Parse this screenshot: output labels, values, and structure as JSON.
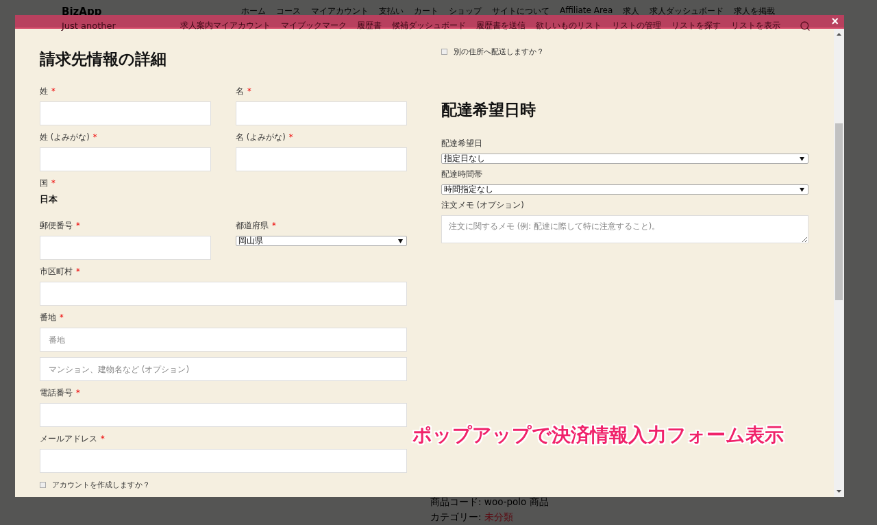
{
  "site": {
    "logo": "BizApp",
    "tagline": "Just another",
    "nav_primary": [
      "ホーム",
      "コース",
      "マイアカウント",
      "支払い",
      "カート",
      "ショップ",
      "サイトについて",
      "Affiliate Area",
      "求人",
      "求人ダッシュボード",
      "求人を掲載"
    ],
    "nav_secondary": [
      "求人案内マイアカウント",
      "マイブックマーク",
      "履歴書",
      "候補ダッシュボード",
      "履歴書を送信",
      "欲しいものリスト",
      "リストの管理",
      "リストを探す",
      "リストを表示"
    ]
  },
  "popup": {
    "close_glyph": "×",
    "billing": {
      "title": "請求先情報の詳細",
      "rows": [
        [
          {
            "kind": "input",
            "label": "姓",
            "mark": "*"
          },
          {
            "kind": "input",
            "label": "名",
            "mark": "*"
          }
        ],
        [
          {
            "kind": "input",
            "label": "姓 (よみがな)",
            "mark": "*"
          },
          {
            "kind": "input",
            "label": "名 (よみがな)",
            "mark": "*"
          }
        ],
        [
          {
            "kind": "static",
            "label": "国",
            "mark": "*",
            "value": "日本"
          }
        ],
        [
          {
            "kind": "input",
            "label": "郵便番号",
            "mark": "*"
          },
          {
            "kind": "select",
            "label": "都道府県",
            "mark": "*",
            "value": "岡山県"
          }
        ],
        [
          {
            "kind": "input",
            "label": "市区町村",
            "mark": "*"
          }
        ],
        [
          {
            "kind": "input",
            "label": "番地",
            "mark": "*",
            "placeholder": "番地"
          }
        ],
        [
          {
            "kind": "input",
            "placeholder": "マンション、建物名など (オプション)"
          }
        ],
        [
          {
            "kind": "input",
            "label": "電話番号",
            "mark": "*"
          }
        ],
        [
          {
            "kind": "input",
            "label": "メールアドレス",
            "mark": "*"
          }
        ],
        [
          {
            "kind": "checkbox",
            "label": "アカウントを作成しますか？",
            "checked": false
          }
        ]
      ]
    },
    "shipping": {
      "kind": "checkbox",
      "label": "別の住所へ配送しますか？",
      "checked": false
    },
    "delivery": {
      "title": "配達希望日時",
      "fields": [
        {
          "kind": "select",
          "label": "配達希望日",
          "value": "指定日なし"
        },
        {
          "kind": "select",
          "label": "配達時間帯",
          "value": "時間指定なし"
        },
        {
          "kind": "textarea",
          "label": "注文メモ (オプション)",
          "placeholder": "注文に関するメモ (例: 配達に際して特に注意すること)。"
        }
      ]
    }
  },
  "annotation": "ポップアップで決済情報入力フォーム表示",
  "product_meta": {
    "sku_line": "商品コード: woo-polo 商品",
    "category_label": "カテゴリー:",
    "category_link": "未分類"
  }
}
